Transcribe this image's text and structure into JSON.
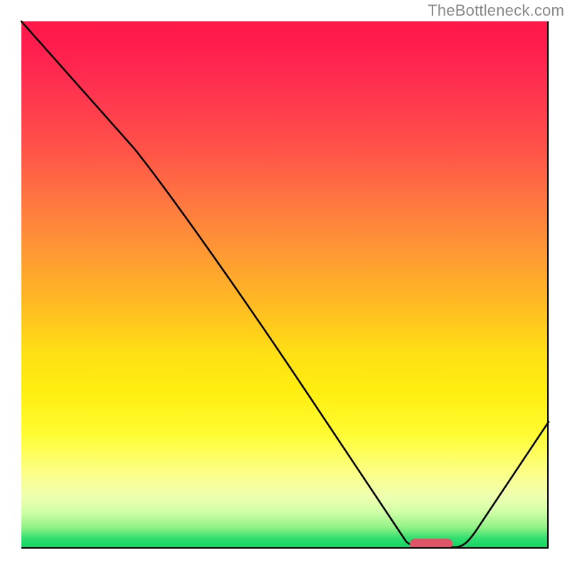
{
  "watermark": "TheBottleneck.com",
  "chart_data": {
    "type": "line",
    "title": "",
    "xlabel": "",
    "ylabel": "",
    "x_range": [
      0,
      100
    ],
    "y_range": [
      0,
      100
    ],
    "series": [
      {
        "name": "curve",
        "x": [
          0,
          20,
          72,
          77,
          82,
          100
        ],
        "y": [
          100,
          76,
          1,
          0,
          0,
          24
        ]
      }
    ],
    "marker": {
      "x_start": 74,
      "x_end": 81,
      "y": 0
    },
    "gradient_stops": [
      {
        "pos": 0,
        "color": "#ff174a"
      },
      {
        "pos": 25,
        "color": "#ff5548"
      },
      {
        "pos": 55,
        "color": "#ffc020"
      },
      {
        "pos": 78,
        "color": "#fffb30"
      },
      {
        "pos": 96,
        "color": "#90f285"
      },
      {
        "pos": 100,
        "color": "#10d060"
      }
    ]
  }
}
